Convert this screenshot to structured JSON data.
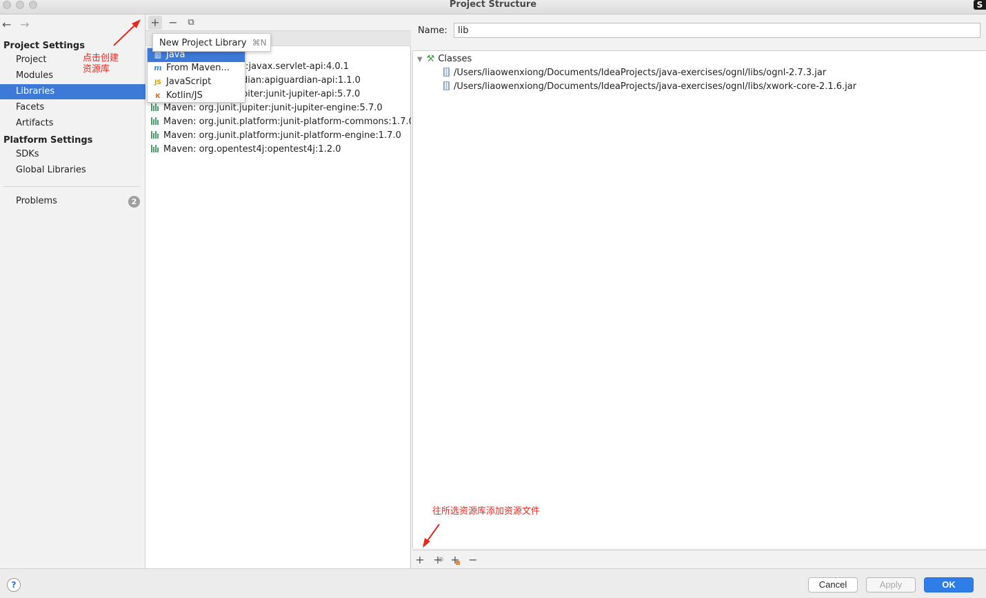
{
  "window": {
    "title": "Project Structure",
    "corner_badge": "S"
  },
  "nav": {
    "back": "←",
    "forward": "→",
    "project_settings_title": "Project Settings",
    "project_items": [
      "Project",
      "Modules",
      "Libraries",
      "Facets",
      "Artifacts"
    ],
    "platform_settings_title": "Platform Settings",
    "platform_items": [
      "SDKs",
      "Global Libraries"
    ],
    "problems": "Problems",
    "problems_count": "2",
    "annotation_line1": "点击创建",
    "annotation_line2": "资源库"
  },
  "toolbar": {
    "add": "+",
    "remove": "−",
    "copy": "⧉"
  },
  "libraries": [
    "t:javax.servlet-api:4.0.1",
    "dian:apiguardian-api:1.1.0",
    "piter:junit-jupiter-api:5.7.0",
    "Maven: org.junit.jupiter:junit-jupiter-engine:5.7.0",
    "Maven: org.junit.platform:junit-platform-commons:1.7.0",
    "Maven: org.junit.platform:junit-platform-engine:1.7.0",
    "Maven: org.opentest4j:opentest4j:1.2.0"
  ],
  "tooltip": {
    "label": "New Project Library",
    "shortcut": "⌘N"
  },
  "dropdown": {
    "items": [
      "Java",
      "From Maven...",
      "JavaScript",
      "Kotlin/JS"
    ]
  },
  "details": {
    "name_label": "Name:",
    "name_value": "lib",
    "classes_label": "Classes",
    "jars": [
      "/Users/liaowenxiong/Documents/IdeaProjects/java-exercises/ognl/libs/ognl-2.7.3.jar",
      "/Users/liaowenxiong/Documents/IdeaProjects/java-exercises/ognl/libs/xwork-core-2.1.6.jar"
    ],
    "annotation": "往所选资源库添加资源文件",
    "tools": {
      "add": "+",
      "add_alt": "+",
      "add_other": "+",
      "remove": "−"
    }
  },
  "footer": {
    "help": "?",
    "cancel": "Cancel",
    "apply": "Apply",
    "ok": "OK"
  },
  "colors": {
    "selection": "#3d79d6",
    "annotation": "#e8281e",
    "ok_button": "#2f7ee8"
  }
}
